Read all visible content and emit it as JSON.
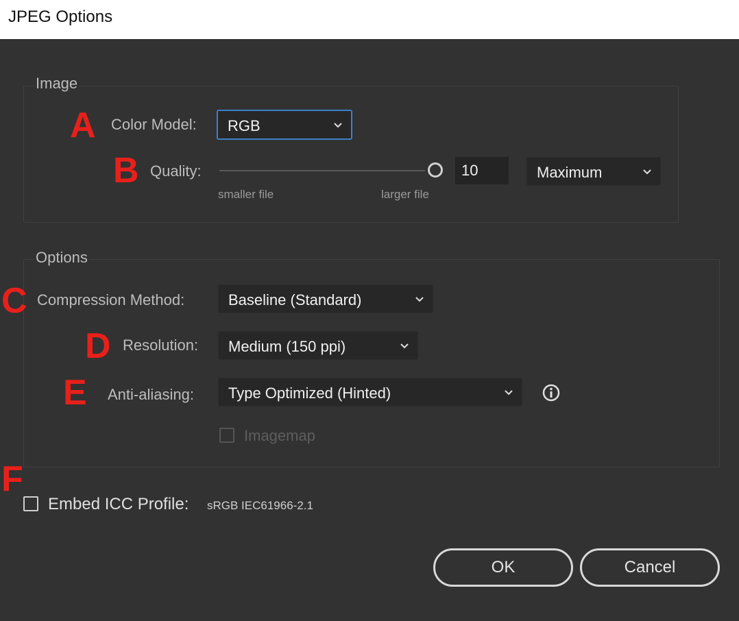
{
  "window": {
    "title": "JPEG Options"
  },
  "image_group": {
    "legend": "Image",
    "color_model": {
      "marker": "A",
      "label": "Color Model:",
      "value": "RGB"
    },
    "quality": {
      "marker": "B",
      "label": "Quality:",
      "value": "10",
      "max": 10,
      "min_caption": "smaller file",
      "max_caption": "larger file",
      "preset": "Maximum"
    }
  },
  "options_group": {
    "legend": "Options",
    "compression": {
      "marker": "C",
      "label": "Compression Method:",
      "value": "Baseline (Standard)"
    },
    "resolution": {
      "marker": "D",
      "label": "Resolution:",
      "value": "Medium (150 ppi)"
    },
    "antialiasing": {
      "marker": "E",
      "label": "Anti-aliasing:",
      "value": "Type Optimized (Hinted)"
    },
    "imagemap": {
      "label": "Imagemap",
      "checked": false,
      "disabled": true
    }
  },
  "embed_icc": {
    "marker": "F",
    "label": "Embed ICC Profile:",
    "profile": "sRGB IEC61966-2.1",
    "checked": false
  },
  "buttons": {
    "ok": "OK",
    "cancel": "Cancel"
  },
  "colors": {
    "background": "#323232",
    "marker": "#e8201b",
    "focus": "#3d7fc9"
  },
  "icons": {
    "dropdown": "chevron-down-icon",
    "info": "info-icon"
  }
}
